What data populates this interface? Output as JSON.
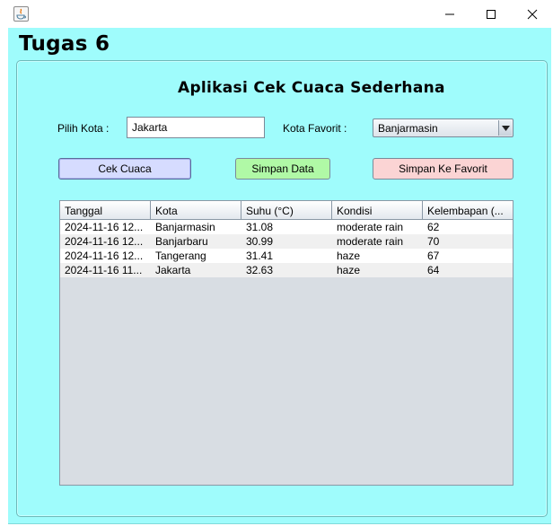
{
  "window": {
    "icon": "java-icon",
    "controls": [
      "minimize-icon",
      "maximize-icon",
      "close-icon"
    ]
  },
  "heading": "Tugas 6",
  "app_title": "Aplikasi Cek Cuaca Sederhana",
  "city_label": "Pilih Kota :",
  "city_input_value": "Jakarta",
  "favorite_label": "Kota Favorit :",
  "favorite_selected": "Banjarmasin",
  "buttons": {
    "check": "Cek Cuaca",
    "save": "Simpan Data",
    "save_favorite": "Simpan Ke Favorit"
  },
  "colors": {
    "background": "#9ffcfc",
    "check_button": "#d6dcff",
    "save_button": "#b0f9a6",
    "favorite_button": "#fbd4d4"
  },
  "table": {
    "columns": [
      "Tanggal",
      "Kota",
      "Suhu (°C)",
      "Kondisi",
      "Kelembapan (..."
    ],
    "rows": [
      [
        "2024-11-16 12...",
        "Banjarmasin",
        "31.08",
        "moderate rain",
        "62"
      ],
      [
        "2024-11-16 12...",
        "Banjarbaru",
        "30.99",
        "moderate rain",
        "70"
      ],
      [
        "2024-11-16 12...",
        "Tangerang",
        "31.41",
        "haze",
        "67"
      ],
      [
        "2024-11-16 11...",
        "Jakarta",
        "32.63",
        "haze",
        "64"
      ]
    ]
  }
}
